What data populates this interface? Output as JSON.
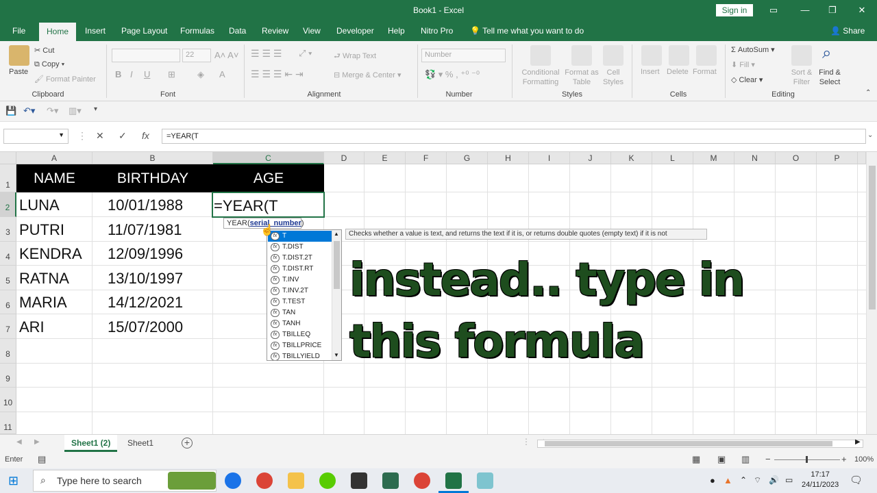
{
  "window": {
    "title": "Book1  -  Excel",
    "signin": "Sign in"
  },
  "tabs": [
    "File",
    "Home",
    "Insert",
    "Page Layout",
    "Formulas",
    "Data",
    "Review",
    "View",
    "Developer",
    "Help",
    "Nitro Pro"
  ],
  "tell_me": "Tell me what you want to do",
  "share": "Share",
  "ribbon": {
    "paste": "Paste",
    "cut": "Cut",
    "copy": "Copy",
    "format_painter": "Format Painter",
    "font_size": "22",
    "wrap_text": "Wrap Text",
    "merge_center": "Merge & Center",
    "number_format": "Number",
    "conditional_formatting": "Conditional Formatting",
    "format_as_table": "Format as Table",
    "cell_styles": "Cell Styles",
    "insert": "Insert",
    "delete": "Delete",
    "format": "Format",
    "autosum": "AutoSum",
    "fill": "Fill",
    "clear": "Clear",
    "sort_filter": "Sort & Filter",
    "find_select": "Find & Select",
    "groups": [
      "Clipboard",
      "Font",
      "Alignment",
      "Number",
      "Styles",
      "Cells",
      "Editing"
    ]
  },
  "formula_bar": {
    "value": "=YEAR(T"
  },
  "columns": [
    "A",
    "B",
    "C",
    "D",
    "E",
    "F",
    "G",
    "H",
    "I",
    "J",
    "K",
    "L",
    "M",
    "N",
    "O",
    "P"
  ],
  "rows": [
    "1",
    "2",
    "3",
    "4",
    "5",
    "6",
    "7",
    "8",
    "9",
    "10",
    "11"
  ],
  "table": {
    "headers": [
      "NAME",
      "BIRTHDAY",
      "AGE"
    ],
    "data": [
      [
        "LUNA",
        "10/01/1988"
      ],
      [
        "PUTRI",
        "11/07/1981"
      ],
      [
        "KENDRA",
        "12/09/1996"
      ],
      [
        "RATNA",
        "13/10/1997"
      ],
      [
        "MARIA",
        "14/12/2021"
      ],
      [
        "ARI",
        "15/07/2000"
      ]
    ],
    "active_cell": "=YEAR(T"
  },
  "autocomplete": {
    "tooltip_fn": "YEAR(",
    "tooltip_arg": "serial_number",
    "tooltip_close": ")",
    "items": [
      "T",
      "T.DIST",
      "T.DIST.2T",
      "T.DIST.RT",
      "T.INV",
      "T.INV.2T",
      "T.TEST",
      "TAN",
      "TANH",
      "TBILLEQ",
      "TBILLPRICE",
      "TBILLYIELD"
    ],
    "description": "Checks whether a value is text, and returns the text if it is, or returns double quotes (empty text) if it is not"
  },
  "overlay_text": [
    "instead.. type in",
    "this formula"
  ],
  "sheets": [
    "Sheet1 (2)",
    "Sheet1"
  ],
  "status": {
    "mode": "Enter",
    "zoom": "100%"
  },
  "taskbar": {
    "search_placeholder": "Type here to search",
    "time": "17:17",
    "date": "24/11/2023"
  }
}
